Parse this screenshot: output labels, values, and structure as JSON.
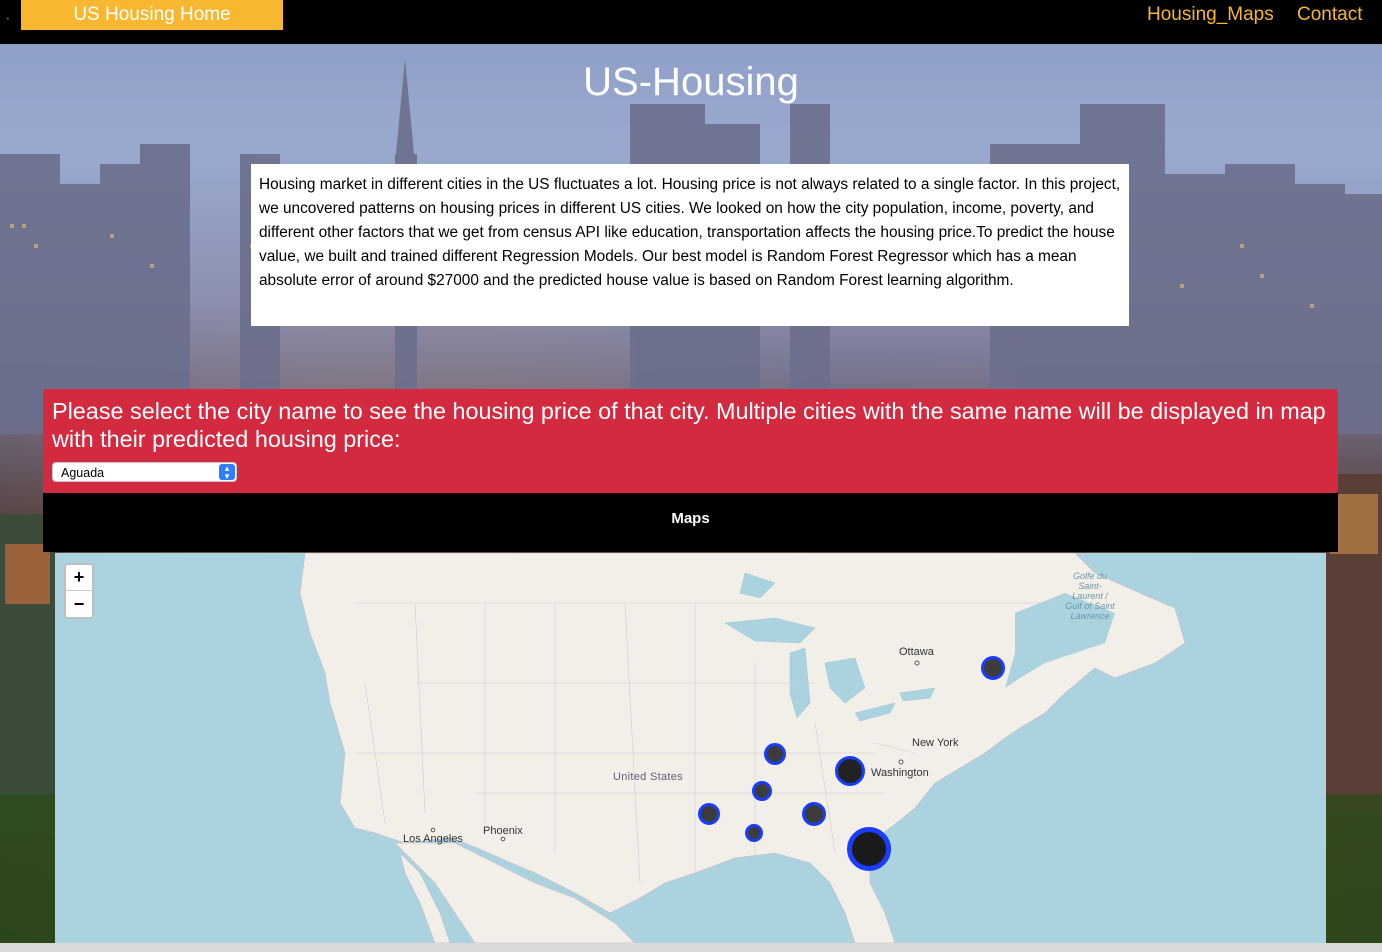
{
  "nav": {
    "brand": "US Housing Home",
    "links": [
      "Housing_Maps",
      "Contact"
    ]
  },
  "hero": {
    "title": "US-Housing",
    "intro": "Housing market in different cities in the US fluctuates a lot. Housing price is not always related to a single factor. In this project, we uncovered patterns on housing prices in different US cities. We looked on how the city population, income, poverty, and different other factors that we get from census API like education, transportation affects the housing price.To predict the house value, we built and trained different Regression Models. Our best model is Random Forest Regressor which has a mean absolute error of around $27000 and the predicted house value is based on Random Forest learning algorithm."
  },
  "selector": {
    "prompt": "Please select the city name to see the housing price of that city. Multiple cities with the same name will be displayed in map with their predicted housing price:",
    "selected_city": "Aguada"
  },
  "maps_section": {
    "header": "Maps",
    "zoom_in": "+",
    "zoom_out": "−",
    "labels": {
      "ottawa": "Ottawa",
      "new_york": "New York",
      "washington": "Washington",
      "united_states": "United States",
      "phoenix": "Phoenix",
      "los_angeles": "Los Angeles",
      "gulf": "Golfe du Saint-Laurent / Gulf of Saint Lawrence"
    }
  },
  "colors": {
    "accent": "#f7b731",
    "panel_red": "#d42a3f",
    "marker_ring": "#1a3cff",
    "water": "#aad3df",
    "land": "#f2efe9"
  }
}
